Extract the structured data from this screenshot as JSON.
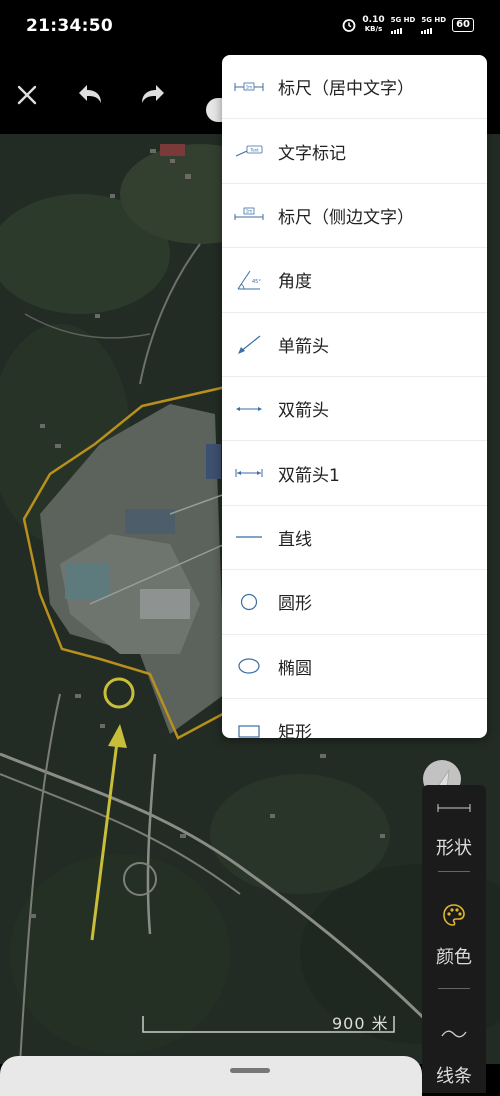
{
  "status_bar": {
    "time": "21:34:50",
    "speed_value": "0.10",
    "speed_unit": "KB/s",
    "network1": "5G HD",
    "network2": "5G HD",
    "battery": "60"
  },
  "toolbar": {
    "close_icon": "close-icon",
    "undo_icon": "undo-icon",
    "redo_icon": "redo-icon"
  },
  "menu": {
    "items": [
      {
        "label": "标尺（居中文字）",
        "icon": "ruler-center-text-icon"
      },
      {
        "label": "文字标记",
        "icon": "text-marker-icon"
      },
      {
        "label": "标尺（侧边文字）",
        "icon": "ruler-side-text-icon"
      },
      {
        "label": "角度",
        "icon": "angle-icon"
      },
      {
        "label": "单箭头",
        "icon": "single-arrow-icon"
      },
      {
        "label": "双箭头",
        "icon": "double-arrow-icon"
      },
      {
        "label": "双箭头1",
        "icon": "double-arrow-1-icon"
      },
      {
        "label": "直线",
        "icon": "line-icon"
      },
      {
        "label": "圆形",
        "icon": "circle-icon"
      },
      {
        "label": "椭圆",
        "icon": "ellipse-icon"
      },
      {
        "label": "矩形",
        "icon": "rectangle-icon"
      }
    ],
    "mini_icon_text": {
      "ruler": "1m",
      "marker": "Text",
      "angle": "45°"
    }
  },
  "side_panel": {
    "shape_label": "形状",
    "color_label": "颜色",
    "line_label": "线条"
  },
  "map": {
    "scale_text": "900 米",
    "annotation_color": "#c9be3a",
    "boundary_color": "#b8901c"
  }
}
